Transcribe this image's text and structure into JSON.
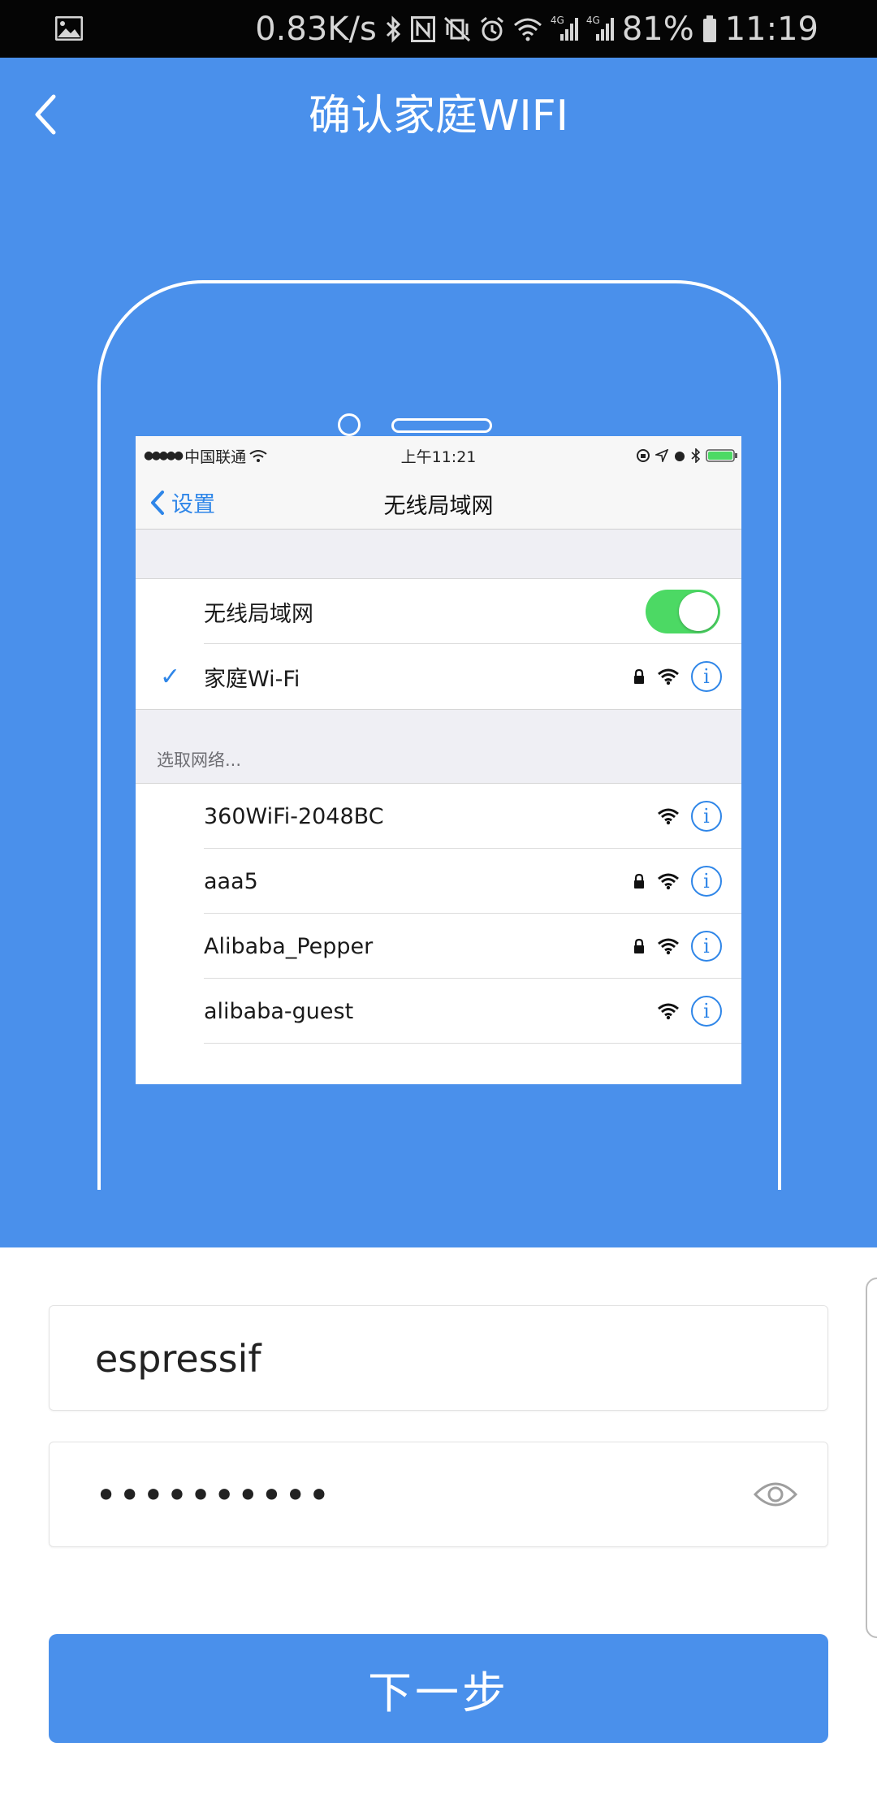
{
  "status_bar": {
    "speed": "0.83K/s",
    "net1": "4G",
    "net2": "4G",
    "battery": "81%",
    "time": "11:19"
  },
  "header": {
    "title": "确认家庭WIFI"
  },
  "illustration": {
    "status_carrier": "中国联通",
    "status_time": "上午11:21",
    "back_label": "设置",
    "nav_title": "无线局域网",
    "wlan_label": "无线局域网",
    "wlan_enabled": true,
    "connected_network": "家庭Wi-Fi",
    "section_header": "选取网络...",
    "networks": [
      {
        "name": "360WiFi-2048BC",
        "locked": false
      },
      {
        "name": "aaa5",
        "locked": true
      },
      {
        "name": "Alibaba_Pepper",
        "locked": true
      },
      {
        "name": "alibaba-guest",
        "locked": false
      }
    ]
  },
  "form": {
    "ssid_value": "espressif",
    "password_masked": "••••••••••",
    "next_label": "下一步"
  },
  "colors": {
    "primary": "#4a90eb",
    "ios_blue": "#2f86e8",
    "toggle_green": "#4cd964"
  }
}
